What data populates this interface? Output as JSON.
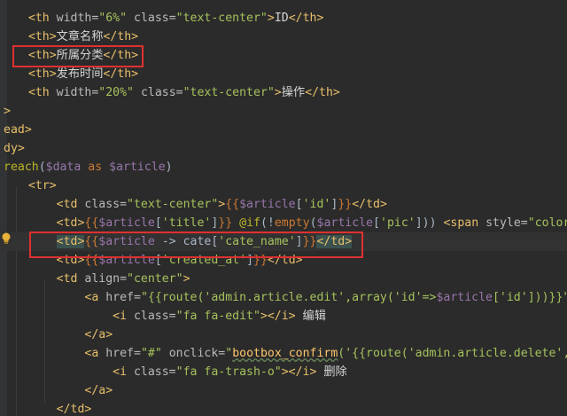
{
  "editor": {
    "lines": [
      {
        "id": "l1",
        "indent": "  ",
        "tokens": [
          {
            "t": "tag",
            "v": "<th "
          },
          {
            "t": "attr",
            "v": "width="
          },
          {
            "t": "str",
            "v": "\"6%\""
          },
          {
            "t": "attr",
            "v": " class="
          },
          {
            "t": "str",
            "v": "\"text-center\""
          },
          {
            "t": "tag",
            "v": ">"
          },
          {
            "t": "text",
            "v": "ID"
          },
          {
            "t": "tag",
            "v": "</th>"
          }
        ]
      },
      {
        "id": "l2",
        "indent": "  ",
        "tokens": [
          {
            "t": "tag",
            "v": "<th>"
          },
          {
            "t": "text",
            "v": "文章名称"
          },
          {
            "t": "tag",
            "v": "</th>"
          }
        ]
      },
      {
        "id": "l3",
        "indent": "  ",
        "tokens": [
          {
            "t": "tag",
            "v": "<th>"
          },
          {
            "t": "text",
            "v": "所属分类"
          },
          {
            "t": "tag",
            "v": "</th>"
          }
        ]
      },
      {
        "id": "l4",
        "indent": "  ",
        "tokens": [
          {
            "t": "tag",
            "v": "<th>"
          },
          {
            "t": "text",
            "v": "发布时间"
          },
          {
            "t": "tag",
            "v": "</th>"
          }
        ]
      },
      {
        "id": "l5",
        "indent": "  ",
        "tokens": [
          {
            "t": "tag",
            "v": "<th "
          },
          {
            "t": "attr",
            "v": "width="
          },
          {
            "t": "str",
            "v": "\"20%\""
          },
          {
            "t": "attr",
            "v": " class="
          },
          {
            "t": "str",
            "v": "\"text-center\""
          },
          {
            "t": "tag",
            "v": ">"
          },
          {
            "t": "text",
            "v": "操作"
          },
          {
            "t": "tag",
            "v": "</th>"
          }
        ]
      },
      {
        "id": "l6",
        "indent": "",
        "tokens": [
          {
            "t": "tag",
            "v": ">"
          }
        ]
      },
      {
        "id": "l7",
        "indent": "",
        "tokens": [
          {
            "t": "tag",
            "v": "ead>"
          }
        ]
      },
      {
        "id": "l8",
        "indent": "",
        "tokens": [
          {
            "t": "tag",
            "v": "dy>"
          }
        ]
      },
      {
        "id": "l9",
        "indent": "",
        "tokens": [
          {
            "t": "dir",
            "v": "reach"
          },
          {
            "t": "punc",
            "v": "("
          },
          {
            "t": "var",
            "v": "$data"
          },
          {
            "t": "php",
            "v": " as "
          },
          {
            "t": "var",
            "v": "$article"
          },
          {
            "t": "punc",
            "v": ")"
          }
        ]
      },
      {
        "id": "l10",
        "indent": "  ",
        "tokens": [
          {
            "t": "tag",
            "v": "<tr>"
          }
        ]
      },
      {
        "id": "l11",
        "indent": "      ",
        "tokens": [
          {
            "t": "tag",
            "v": "<td "
          },
          {
            "t": "attr",
            "v": "class="
          },
          {
            "t": "str",
            "v": "\"text-center\""
          },
          {
            "t": "tag",
            "v": ">"
          },
          {
            "t": "brace",
            "v": "{{"
          },
          {
            "t": "var",
            "v": "$article"
          },
          {
            "t": "punc",
            "v": "["
          },
          {
            "t": "str",
            "v": "'id'"
          },
          {
            "t": "punc",
            "v": "]"
          },
          {
            "t": "brace",
            "v": "}}"
          },
          {
            "t": "tag",
            "v": "</td>"
          }
        ]
      },
      {
        "id": "l12",
        "indent": "      ",
        "tokens": [
          {
            "t": "tag",
            "v": "<td>"
          },
          {
            "t": "brace",
            "v": "{{"
          },
          {
            "t": "var",
            "v": "$article"
          },
          {
            "t": "punc",
            "v": "["
          },
          {
            "t": "str",
            "v": "'title'"
          },
          {
            "t": "punc",
            "v": "]"
          },
          {
            "t": "brace",
            "v": "}}"
          },
          {
            "t": "dir",
            "v": " @if"
          },
          {
            "t": "punc",
            "v": "(!"
          },
          {
            "t": "php",
            "v": "empty"
          },
          {
            "t": "punc",
            "v": "("
          },
          {
            "t": "var",
            "v": "$article"
          },
          {
            "t": "punc",
            "v": "["
          },
          {
            "t": "str",
            "v": "'pic'"
          },
          {
            "t": "punc",
            "v": "]))"
          },
          {
            "t": "tag",
            "v": " <span "
          },
          {
            "t": "attr",
            "v": "style="
          },
          {
            "t": "str",
            "v": "\"color:"
          }
        ]
      },
      {
        "id": "l13",
        "indent": "      ",
        "current": true,
        "tokens": [
          {
            "t": "tag",
            "hl": true,
            "v": "<td>"
          },
          {
            "t": "brace",
            "v": "{{"
          },
          {
            "t": "var",
            "v": "$article"
          },
          {
            "t": "punc",
            "v": " -> cate["
          },
          {
            "t": "str",
            "v": "'cate_name'"
          },
          {
            "t": "punc",
            "v": "]"
          },
          {
            "t": "brace",
            "v": "}}"
          },
          {
            "t": "tag",
            "hl": true,
            "v": "</td>"
          }
        ]
      },
      {
        "id": "l14",
        "indent": "      ",
        "tokens": [
          {
            "t": "tag",
            "v": "<td>"
          },
          {
            "t": "brace",
            "v": "{{"
          },
          {
            "t": "var",
            "v": "$article"
          },
          {
            "t": "punc",
            "v": "["
          },
          {
            "t": "str",
            "v": "'created_at'"
          },
          {
            "t": "punc",
            "v": "]"
          },
          {
            "t": "brace",
            "v": "}}"
          },
          {
            "t": "tag",
            "v": "</td>"
          }
        ]
      },
      {
        "id": "l15",
        "indent": "      ",
        "tokens": [
          {
            "t": "tag",
            "v": "<td "
          },
          {
            "t": "attr",
            "v": "align="
          },
          {
            "t": "str",
            "v": "\"center\""
          },
          {
            "t": "tag",
            "v": ">"
          }
        ]
      },
      {
        "id": "l16",
        "indent": "          ",
        "tokens": [
          {
            "t": "tag",
            "v": "<a "
          },
          {
            "t": "attr",
            "v": "href="
          },
          {
            "t": "str",
            "v": "\"{{route("
          },
          {
            "t": "str",
            "v": "'admin.article.edit'"
          },
          {
            "t": "str",
            "v": ",array("
          },
          {
            "t": "str",
            "v": "'id'"
          },
          {
            "t": "str",
            "v": "=>"
          },
          {
            "t": "var",
            "v": "$article"
          },
          {
            "t": "str",
            "v": "["
          },
          {
            "t": "str",
            "v": "'id'"
          },
          {
            "t": "str",
            "v": "]))}}\""
          }
        ]
      },
      {
        "id": "l17",
        "indent": "              ",
        "tokens": [
          {
            "t": "tag",
            "v": "<i "
          },
          {
            "t": "attr",
            "v": "class="
          },
          {
            "t": "str",
            "v": "\"fa fa-edit\""
          },
          {
            "t": "tag",
            "v": "></i>"
          },
          {
            "t": "text",
            "v": " 编辑"
          }
        ]
      },
      {
        "id": "l18",
        "indent": "          ",
        "tokens": [
          {
            "t": "tag",
            "v": "</a>"
          }
        ]
      },
      {
        "id": "l19",
        "indent": "          ",
        "tokens": [
          {
            "t": "tag",
            "v": "<a "
          },
          {
            "t": "attr",
            "v": "href="
          },
          {
            "t": "str",
            "v": "\"#\""
          },
          {
            "t": "attr",
            "v": " onclick="
          },
          {
            "t": "str",
            "v": "\""
          },
          {
            "t": "fn",
            "v": "bootbox_confirm"
          },
          {
            "t": "str",
            "v": "('{{route("
          },
          {
            "t": "str",
            "v": "'admin.article.delete'"
          },
          {
            "t": "str",
            "v": ",a"
          }
        ]
      },
      {
        "id": "l20",
        "indent": "              ",
        "tokens": [
          {
            "t": "tag",
            "v": "<i "
          },
          {
            "t": "attr",
            "v": "class="
          },
          {
            "t": "str",
            "v": "\"fa fa-trash-o\""
          },
          {
            "t": "tag",
            "v": "></i>"
          },
          {
            "t": "text",
            "v": " 删除"
          }
        ]
      },
      {
        "id": "l21",
        "indent": "          ",
        "tokens": [
          {
            "t": "tag",
            "v": "</a>"
          }
        ]
      },
      {
        "id": "l22",
        "indent": "      ",
        "tokens": [
          {
            "t": "tag",
            "v": "</td>"
          }
        ]
      }
    ]
  },
  "colors": {
    "background": "#2b2b2b",
    "annotation_box": "#e03030",
    "tag": "#e8bf6a",
    "string": "#a5c25c",
    "variable": "#9876aa",
    "keyword": "#cc7832"
  },
  "icons": {
    "intention_bulb": "lightbulb-icon"
  }
}
